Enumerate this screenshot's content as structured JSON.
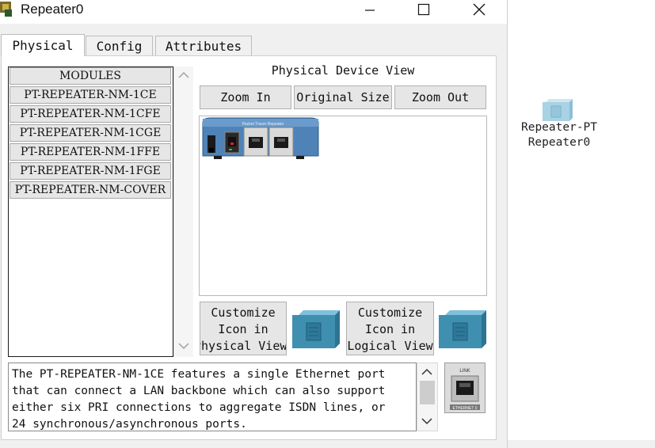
{
  "window": {
    "title": "Repeater0",
    "minimize_icon": "minimize-icon",
    "maximize_icon": "maximize-icon",
    "close_icon": "close-icon"
  },
  "tabs": [
    {
      "label": "Physical",
      "active": true
    },
    {
      "label": "Config",
      "active": false
    },
    {
      "label": "Attributes",
      "active": false
    }
  ],
  "modules": {
    "header": "MODULES",
    "items": [
      "PT-REPEATER-NM-1CE",
      "PT-REPEATER-NM-1CFE",
      "PT-REPEATER-NM-1CGE",
      "PT-REPEATER-NM-1FFE",
      "PT-REPEATER-NM-1FGE",
      "PT-REPEATER-NM-COVER"
    ]
  },
  "device_view": {
    "label": "Physical Device View",
    "zoom_in": "Zoom In",
    "original_size": "Original Size",
    "zoom_out": "Zoom Out",
    "device_brand": "Packet Tracer Repeater"
  },
  "customize": {
    "physical_line1": "Customize",
    "physical_line2": "Icon in",
    "physical_line3": "Physical View",
    "logical_line1": "Customize",
    "logical_line2": "Icon in",
    "logical_line3": "Logical View"
  },
  "description": "The PT-REPEATER-NM-1CE features a single Ethernet port that can connect a LAN backbone which can also support either six PRI connections to aggregate ISDN lines, or 24 synchronous/asynchronous ports.",
  "port_image": {
    "top_label": "LINK",
    "bottom_label": "ETHERNET 0"
  },
  "workspace": {
    "device_model": "Repeater-PT",
    "device_name": "Repeater0"
  },
  "colors": {
    "device_blue": "#4f83b8",
    "cube_teal": "#3f8fb0",
    "window_bg": "#f0f0f0"
  }
}
